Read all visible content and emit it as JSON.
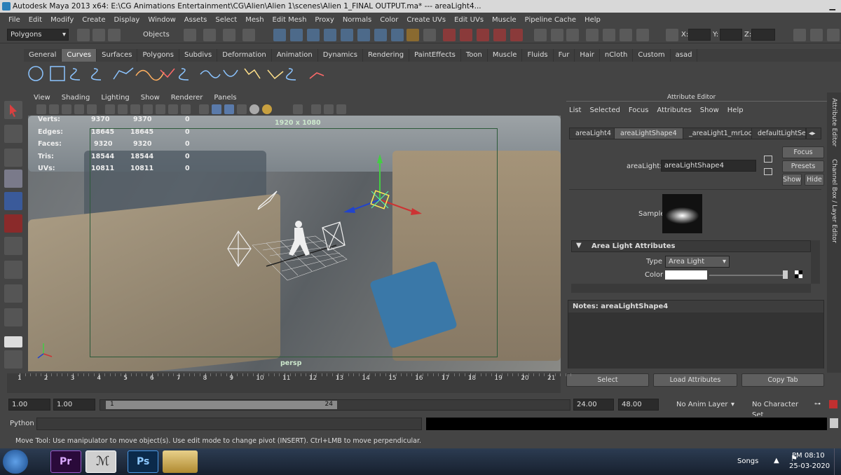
{
  "window": {
    "title": "Autodesk Maya 2013 x64: E:\\CG Animations Entertainment\\CG\\Alien\\Alien 1\\scenes\\Alien 1_FINAL OUTPUT.ma*   ---   areaLight4..."
  },
  "menubar": [
    "File",
    "Edit",
    "Modify",
    "Create",
    "Display",
    "Window",
    "Assets",
    "Select",
    "Mesh",
    "Edit Mesh",
    "Proxy",
    "Normals",
    "Color",
    "Create UVs",
    "Edit UVs",
    "Muscle",
    "Pipeline Cache",
    "Help"
  ],
  "statusline": {
    "mode": "Polygons",
    "selection_mode": "Objects",
    "x_label": "X:",
    "y_label": "Y:",
    "z_label": "Z:"
  },
  "shelf_tabs": [
    "General",
    "Curves",
    "Surfaces",
    "Polygons",
    "Subdivs",
    "Deformation",
    "Animation",
    "Dynamics",
    "Rendering",
    "PaintEffects",
    "Toon",
    "Muscle",
    "Fluids",
    "Fur",
    "Hair",
    "nCloth",
    "Custom",
    "asad"
  ],
  "active_shelf_tab": "Curves",
  "viewport": {
    "menu": [
      "View",
      "Shading",
      "Lighting",
      "Show",
      "Renderer",
      "Panels"
    ],
    "resolution": "1920 x 1080",
    "camera": "persp",
    "hud_stats": [
      {
        "label": "Verts:",
        "v1": "9370",
        "v2": "9370",
        "v3": "0"
      },
      {
        "label": "Edges:",
        "v1": "18645",
        "v2": "18645",
        "v3": "0"
      },
      {
        "label": "Faces:",
        "v1": "9320",
        "v2": "9320",
        "v3": "0"
      },
      {
        "label": "Tris:",
        "v1": "18544",
        "v2": "18544",
        "v3": "0"
      },
      {
        "label": "UVs:",
        "v1": "10811",
        "v2": "10811",
        "v3": "0"
      }
    ]
  },
  "attribute_editor": {
    "title": "Attribute Editor",
    "menu": [
      "List",
      "Selected",
      "Focus",
      "Attributes",
      "Show",
      "Help"
    ],
    "tabs": [
      "areaLight4",
      "areaLightShape4",
      "_areaLight1_mrLoc",
      "defaultLightSet"
    ],
    "active_tab": "areaLightShape4",
    "node_label": "areaLight:",
    "node_value": "areaLightShape4",
    "focus_btn": "Focus",
    "presets_btn": "Presets",
    "show_btn": "Show",
    "hide_btn": "Hide",
    "sample_label": "Sample",
    "section": "Area Light Attributes",
    "type_label": "Type",
    "type_value": "Area Light",
    "color_label": "Color",
    "notes_label": "Notes:  areaLightShape4",
    "select_btn": "Select",
    "load_btn": "Load Attributes",
    "copy_btn": "Copy Tab"
  },
  "side_tabs": {
    "attr": "Attribute Editor",
    "channel": "Channel Box / Layer Editor"
  },
  "timeline": {
    "ticks": [
      "1",
      "2",
      "3",
      "4",
      "5",
      "6",
      "7",
      "8",
      "9",
      "10",
      "11",
      "12",
      "13",
      "14",
      "15",
      "16",
      "17",
      "18",
      "19",
      "20",
      "21"
    ]
  },
  "range": {
    "start": "1.00",
    "current": "1.00",
    "slider_start": "1",
    "slider_end": "24",
    "end": "24.00",
    "end2": "48.00",
    "anim_layer": "No Anim Layer",
    "character_set": "No Character Set"
  },
  "cmdline": {
    "label": "Python"
  },
  "helpline": "Move Tool: Use manipulator to move object(s). Use edit mode to change pivot (INSERT).  Ctrl+LMB to move perpendicular.",
  "taskbar": {
    "pr": "Pr",
    "ps": "Ps",
    "tray_label": "Songs",
    "time": "PM 08:10",
    "date": "25-03-2020"
  },
  "colors": {
    "accent_viewport_gate": "#2c5a3a",
    "pr": "#2a0a3a",
    "ps": "#0b2a4a"
  }
}
